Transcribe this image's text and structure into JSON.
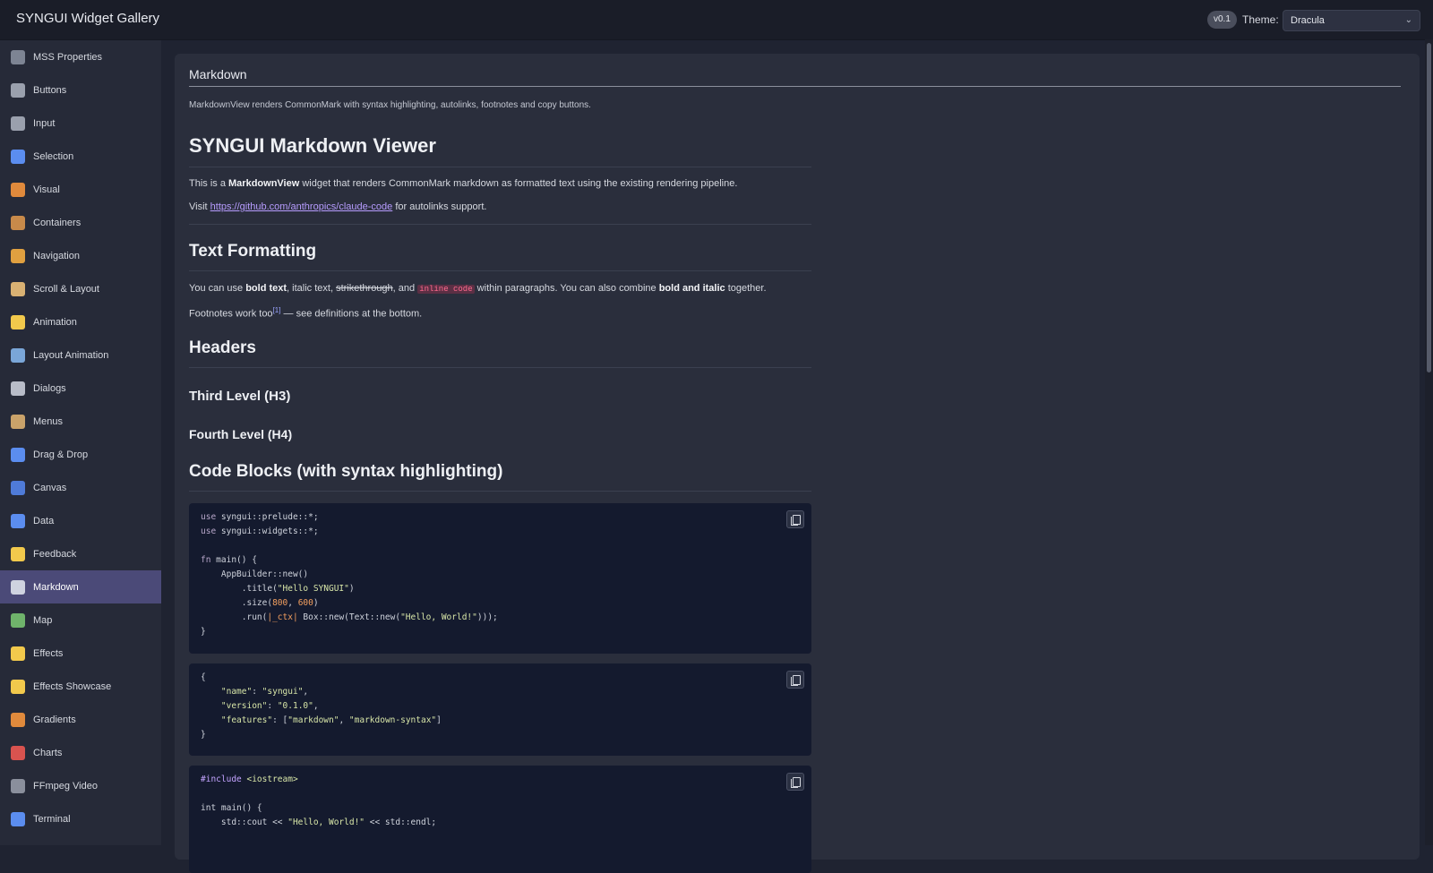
{
  "app": {
    "title": "SYNGUI Widget Gallery",
    "version": "v0.1",
    "theme_label": "Theme:",
    "theme_value": "Dracula"
  },
  "sidebar": {
    "items": [
      {
        "label": "MSS Properties",
        "icon": "grid-icon",
        "color": "#7d8493"
      },
      {
        "label": "Buttons",
        "icon": "radio-button-icon",
        "color": "#9aa0ad"
      },
      {
        "label": "Input",
        "icon": "keyboard-icon",
        "color": "#9aa0ad"
      },
      {
        "label": "Selection",
        "icon": "checkbox-icon",
        "color": "#5b8def"
      },
      {
        "label": "Visual",
        "icon": "palette-icon",
        "color": "#e08a3c"
      },
      {
        "label": "Containers",
        "icon": "box-icon",
        "color": "#c88a4a"
      },
      {
        "label": "Navigation",
        "icon": "compass-icon",
        "color": "#e0a040"
      },
      {
        "label": "Scroll & Layout",
        "icon": "scroll-icon",
        "color": "#d9b173"
      },
      {
        "label": "Animation",
        "icon": "sparkles-icon",
        "color": "#f2c94c"
      },
      {
        "label": "Layout Animation",
        "icon": "ruler-icon",
        "color": "#7aa6d8"
      },
      {
        "label": "Dialogs",
        "icon": "speech-bubble-icon",
        "color": "#b8bcc8"
      },
      {
        "label": "Menus",
        "icon": "clipboard-icon",
        "color": "#c9a26a"
      },
      {
        "label": "Drag & Drop",
        "icon": "refresh-icon",
        "color": "#5b8def"
      },
      {
        "label": "Canvas",
        "icon": "paintbrush-icon",
        "color": "#4f7bd8"
      },
      {
        "label": "Data",
        "icon": "bar-chart-icon",
        "color": "#5b8def"
      },
      {
        "label": "Feedback",
        "icon": "lightbulb-icon",
        "color": "#f2c94c"
      },
      {
        "label": "Markdown",
        "icon": "document-icon",
        "color": "#cfd3e0",
        "active": true
      },
      {
        "label": "Map",
        "icon": "map-icon",
        "color": "#6fb36b"
      },
      {
        "label": "Effects",
        "icon": "lightning-icon",
        "color": "#f2c94c"
      },
      {
        "label": "Effects Showcase",
        "icon": "star-icon",
        "color": "#f2c94c"
      },
      {
        "label": "Gradients",
        "icon": "palette-icon",
        "color": "#e08a3c"
      },
      {
        "label": "Charts",
        "icon": "line-chart-icon",
        "color": "#d9534f"
      },
      {
        "label": "FFmpeg Video",
        "icon": "clapper-icon",
        "color": "#8a8f9c"
      },
      {
        "label": "Terminal",
        "icon": "monitor-icon",
        "color": "#5b8def"
      }
    ]
  },
  "main": {
    "section_title": "Markdown",
    "section_desc": "MarkdownView renders CommonMark with syntax highlighting, autolinks, footnotes and copy buttons.",
    "doc": {
      "h1": "SYNGUI Markdown Viewer",
      "intro_pre": "This is a ",
      "intro_bold": "MarkdownView",
      "intro_post": " widget that renders CommonMark markdown as formatted text using the existing rendering pipeline.",
      "visit_pre": "Visit ",
      "visit_link": "https://github.com/anthropics/claude-code",
      "visit_post": " for autolinks support.",
      "h2_formatting": "Text Formatting",
      "fmt_1": "You can use ",
      "fmt_bold": "bold text",
      "fmt_2": ", italic text, ",
      "fmt_strike": "strikethrough",
      "fmt_3": ", and ",
      "fmt_code": "inline code",
      "fmt_4": " within paragraphs. You can also combine ",
      "fmt_bold_italic": "bold and italic",
      "fmt_5": " together.",
      "fn_pre": "Footnotes work too",
      "fn_ref": "[1]",
      "fn_post": " — see definitions at the bottom.",
      "h2_headers": "Headers",
      "h3": "Third Level (H3)",
      "h4": "Fourth Level (H4)",
      "h2_code": "Code Blocks (with syntax highlighting)"
    },
    "code_blocks": {
      "rust": {
        "l1_kw": "use",
        "l1": " syngui::prelude::*;",
        "l2_kw": "use",
        "l2": " syngui::widgets::*;",
        "l3_kw": "fn",
        "l3": " main() {",
        "l4": "    AppBuilder::new()",
        "l5_a": "        .title(",
        "l5_s": "\"Hello SYNGUI\"",
        "l5_b": ")",
        "l6_a": "        .size(",
        "l6_n1": "800",
        "l6_c": ", ",
        "l6_n2": "600",
        "l6_b": ")",
        "l7_a": "        .run(",
        "l7_p": "|_ctx|",
        "l7_b": " Box::new(Text::new(",
        "l7_s": "\"Hello, World!\"",
        "l7_c": ")));",
        "l8": "}"
      },
      "json": {
        "l1": "{",
        "l2_k": "    \"name\"",
        "l2_c": ": ",
        "l2_v": "\"syngui\"",
        "l2_e": ",",
        "l3_k": "    \"version\"",
        "l3_c": ": ",
        "l3_v": "\"0.1.0\"",
        "l3_e": ",",
        "l4_k": "    \"features\"",
        "l4_c": ": [",
        "l4_v1": "\"markdown\"",
        "l4_m": ", ",
        "l4_v2": "\"markdown-syntax\"",
        "l4_e": "]",
        "l5": "}"
      },
      "cpp": {
        "l1_kw": "#include",
        "l1_s": " <iostream>",
        "l2": "int main() {",
        "l3_a": "    std::cout << ",
        "l3_s": "\"Hello, World!\"",
        "l3_b": " << std::endl;"
      }
    }
  }
}
